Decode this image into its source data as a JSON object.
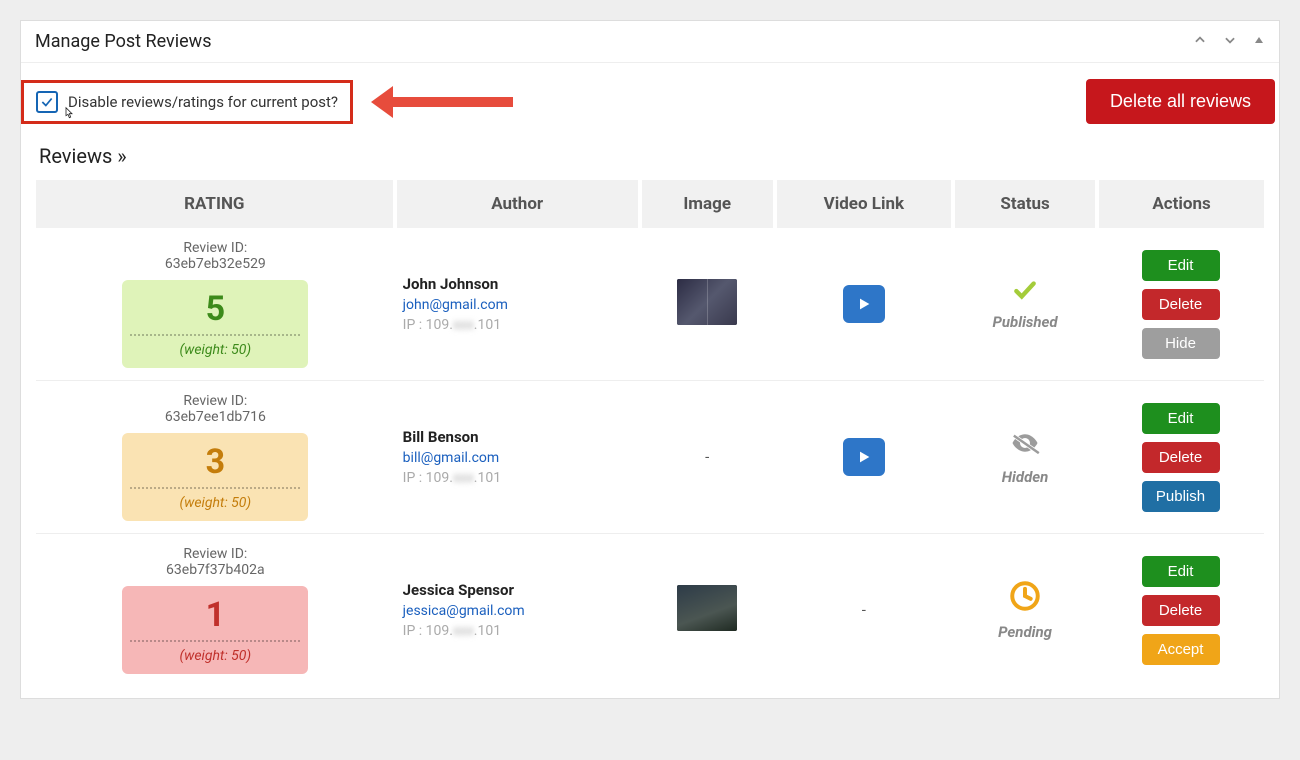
{
  "panel": {
    "title": "Manage Post Reviews"
  },
  "disable_checkbox": {
    "label": "Disable reviews/ratings for current post?",
    "checked": true
  },
  "buttons": {
    "delete_all": "Delete all reviews"
  },
  "section": {
    "subtitle": "Reviews »"
  },
  "columns": {
    "rating": "RATING",
    "author": "Author",
    "image": "Image",
    "video": "Video Link",
    "status": "Status",
    "actions": "Actions"
  },
  "labels": {
    "review_id": "Review ID:",
    "weight_prefix": "(weight: ",
    "weight_suffix": ")",
    "ip_prefix": "IP : "
  },
  "action_labels": {
    "edit": "Edit",
    "delete": "Delete",
    "hide": "Hide",
    "publish": "Publish",
    "accept": "Accept"
  },
  "status_labels": {
    "published": "Published",
    "hidden": "Hidden",
    "pending": "Pending"
  },
  "colors": {
    "accent_red": "#c6171c",
    "highlight_border": "#d42c1a",
    "play_blue": "#2e76c8",
    "link_blue": "#1a5fbe"
  },
  "rows": [
    {
      "review_id": "63eb7eb32e529",
      "rating": "5",
      "weight": "50",
      "badge_class": "badge-green",
      "author_name": "John Johnson",
      "author_email": "john@gmail.com",
      "author_ip_clear1": "109.",
      "author_ip_blur": "xxx",
      "author_ip_clear2": ".101",
      "has_image": true,
      "thumb_variant": "thumb",
      "has_video": true,
      "status": "published",
      "status_icon": "check",
      "status_color": "#a4cc3a",
      "actions": [
        "edit",
        "delete",
        "hide"
      ]
    },
    {
      "review_id": "63eb7ee1db716",
      "rating": "3",
      "weight": "50",
      "badge_class": "badge-yellow",
      "author_name": "Bill Benson",
      "author_email": "bill@gmail.com",
      "author_ip_clear1": "109.",
      "author_ip_blur": "xxx",
      "author_ip_clear2": ".101",
      "has_image": false,
      "thumb_variant": "",
      "has_video": true,
      "status": "hidden",
      "status_icon": "eye-slash",
      "status_color": "#9c9c9c",
      "actions": [
        "edit",
        "delete",
        "publish"
      ]
    },
    {
      "review_id": "63eb7f37b402a",
      "rating": "1",
      "weight": "50",
      "badge_class": "badge-red",
      "author_name": "Jessica Spensor",
      "author_email": "jessica@gmail.com",
      "author_ip_clear1": "109.",
      "author_ip_blur": "xxx",
      "author_ip_clear2": ".101",
      "has_image": true,
      "thumb_variant": "thumb thumb2",
      "has_video": false,
      "status": "pending",
      "status_icon": "clock",
      "status_color": "#f0a518",
      "actions": [
        "edit",
        "delete",
        "accept"
      ]
    }
  ]
}
